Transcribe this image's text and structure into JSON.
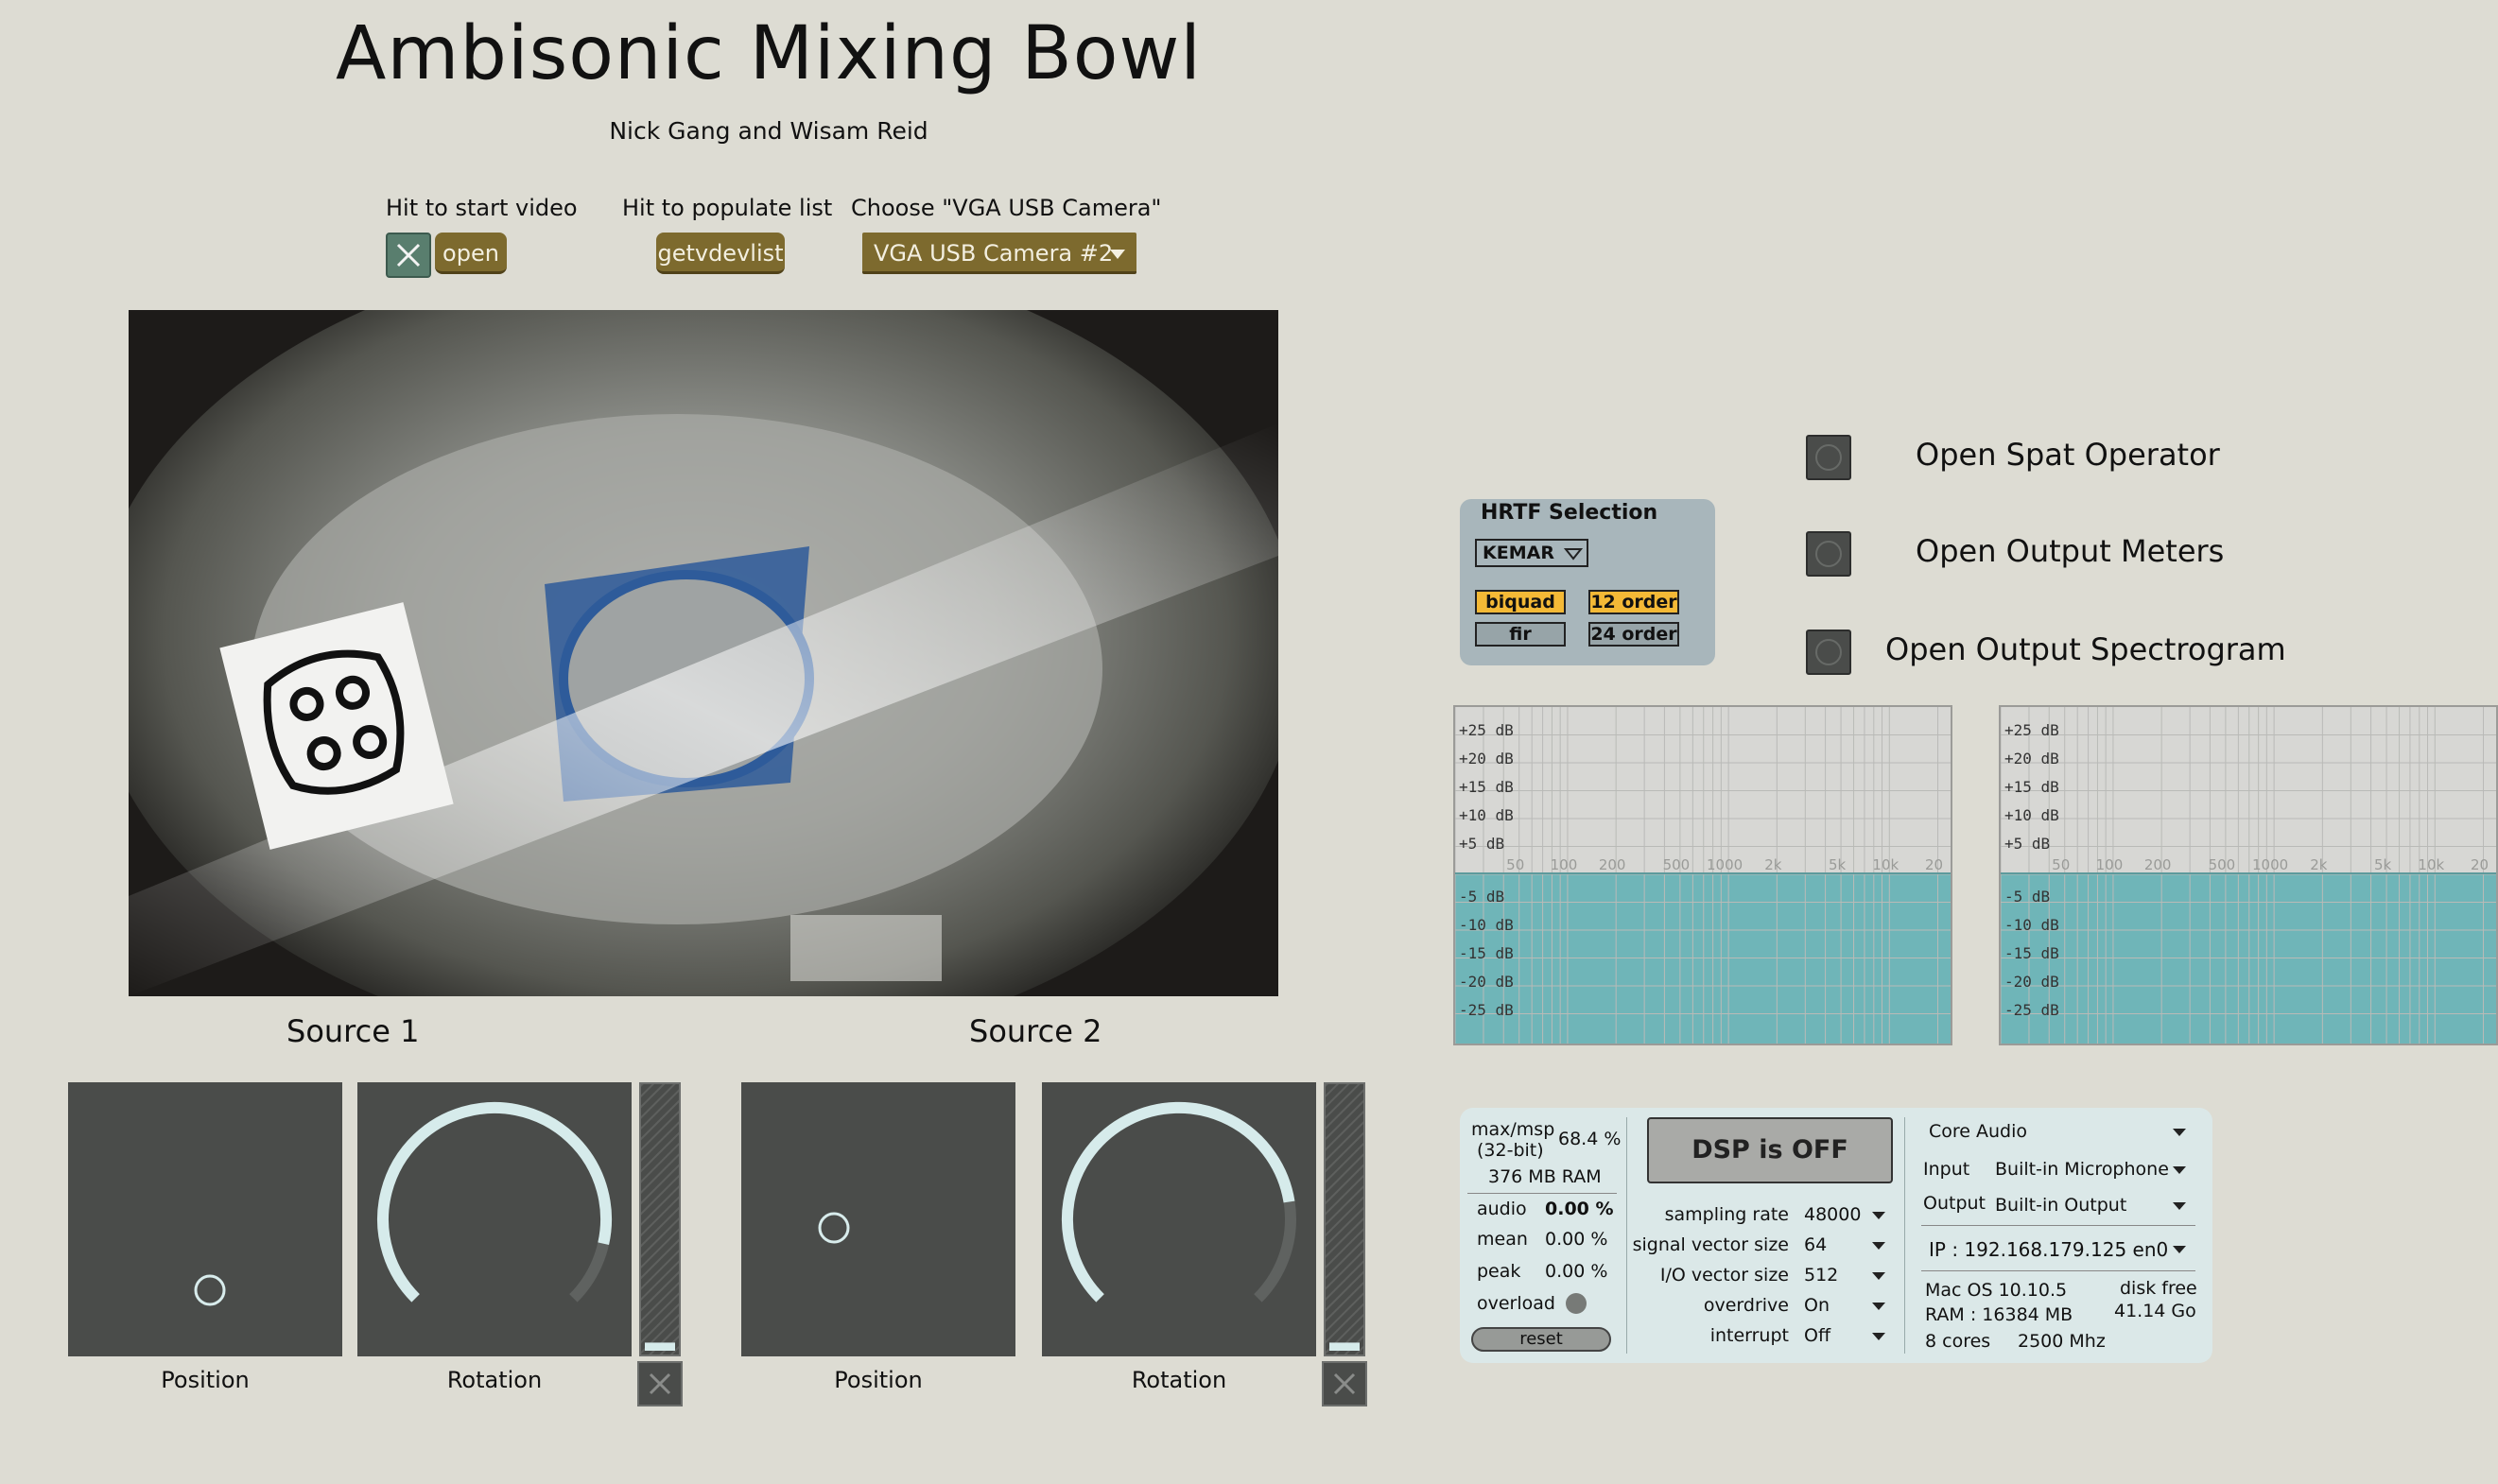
{
  "header": {
    "title": "Ambisonic Mixing Bowl",
    "subtitle": "Nick Gang and Wisam Reid"
  },
  "video_controls": {
    "start_label": "Hit to start video",
    "open_button": "open",
    "populate_label": "Hit to populate list",
    "getvdevlist_button": "getvdevlist",
    "choose_label": "Choose \"VGA USB Camera\"",
    "camera_selected": "VGA USB Camera #2"
  },
  "sources": [
    {
      "label": "Source 1",
      "position_label": "Position",
      "rotation_label": "Rotation",
      "rotation_fraction": 0.88,
      "meter_level": 0.03
    },
    {
      "label": "Source 2",
      "position_label": "Position",
      "rotation_label": "Rotation",
      "rotation_fraction": 0.8,
      "meter_level": 0.03
    }
  ],
  "toggles": [
    {
      "label": "Open Spat Operator",
      "on": false
    },
    {
      "label": "Open Output Meters",
      "on": false
    },
    {
      "label": "Open Output Spectrogram",
      "on": false
    }
  ],
  "hrtf": {
    "title": "HRTF Selection",
    "selected": "KEMAR",
    "buttons": [
      {
        "label": "biquad",
        "active": true
      },
      {
        "label": "12 order",
        "active": true
      },
      {
        "label": "fir",
        "active": false
      },
      {
        "label": "24 order",
        "active": false
      }
    ]
  },
  "eq": {
    "db_top": [
      "+25 dB",
      "+20 dB",
      "+15 dB",
      "+10 dB",
      "+5 dB"
    ],
    "db_bottom": [
      "-5 dB",
      "-10 dB",
      "-15 dB",
      "-20 dB",
      "-25 dB"
    ],
    "freq": [
      "50",
      "100",
      "200",
      "500",
      "1000",
      "2k",
      "5k",
      "10k",
      "20"
    ]
  },
  "dsp": {
    "app_label": "max/msp",
    "bits_label": "(32-bit)",
    "cpu": "68.4 %",
    "ram": "376 MB RAM",
    "audio_label": "audio",
    "audio_value": "0.00 %",
    "mean_label": "mean",
    "mean_value": "0.00 %",
    "peak_label": "peak",
    "peak_value": "0.00 %",
    "overload_label": "overload",
    "reset_button": "reset",
    "dsp_button": "DSP is OFF",
    "params": [
      {
        "label": "sampling rate",
        "value": "48000"
      },
      {
        "label": "signal vector size",
        "value": "64"
      },
      {
        "label": "I/O vector size",
        "value": "512"
      },
      {
        "label": "overdrive",
        "value": "On"
      },
      {
        "label": "interrupt",
        "value": "Off"
      }
    ],
    "driver": "Core Audio",
    "input_label": "Input",
    "input_value": "Built-in Microphone",
    "output_label": "Output",
    "output_value": "Built-in Output",
    "ip": "IP : 192.168.179.125 en0",
    "os": "Mac OS 10.10.5",
    "ram_total": "RAM : 16384 MB",
    "cores": "8 cores",
    "mhz": "2500 Mhz",
    "disk_label": "disk free",
    "disk_value": "41.14 Go"
  }
}
